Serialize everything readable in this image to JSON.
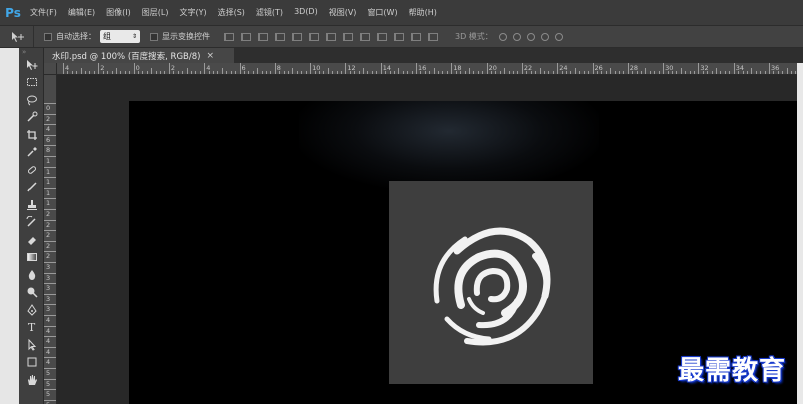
{
  "app": {
    "logo": "Ps",
    "menu": [
      "文件(F)",
      "编辑(E)",
      "图像(I)",
      "图层(L)",
      "文字(Y)",
      "选择(S)",
      "滤镜(T)",
      "3D(D)",
      "视图(V)",
      "窗口(W)",
      "帮助(H)"
    ]
  },
  "options": {
    "auto_select_label": "自动选择：",
    "auto_select_value": "组",
    "show_transform_label": "显示变换控件",
    "mode3d_label": "3D 模式："
  },
  "document": {
    "tab_title": "水印.psd @ 100% (百度搜索, RGB/8)",
    "tab_close": "×"
  },
  "rulers": {
    "top": [
      "4",
      "2",
      "0",
      "2",
      "4",
      "6",
      "8",
      "10",
      "12",
      "14",
      "16",
      "18",
      "20",
      "22",
      "24",
      "26",
      "28",
      "30",
      "32",
      "34",
      "36"
    ],
    "left": [
      "0",
      "2",
      "4",
      "6",
      "8",
      "1",
      "1",
      "1",
      "1",
      "1",
      "2",
      "2",
      "2",
      "2",
      "2",
      "3",
      "3",
      "3",
      "3",
      "3",
      "4",
      "4",
      "4",
      "4",
      "4",
      "5",
      "5",
      "5",
      "5",
      "5",
      "6"
    ]
  },
  "watermark": {
    "text": "最需教育"
  },
  "colors": {
    "accent": "#41a7e8",
    "canvas": "#000000",
    "logo_bg": "#3e3e3e",
    "watermark_outline": "#1a3ccf"
  }
}
